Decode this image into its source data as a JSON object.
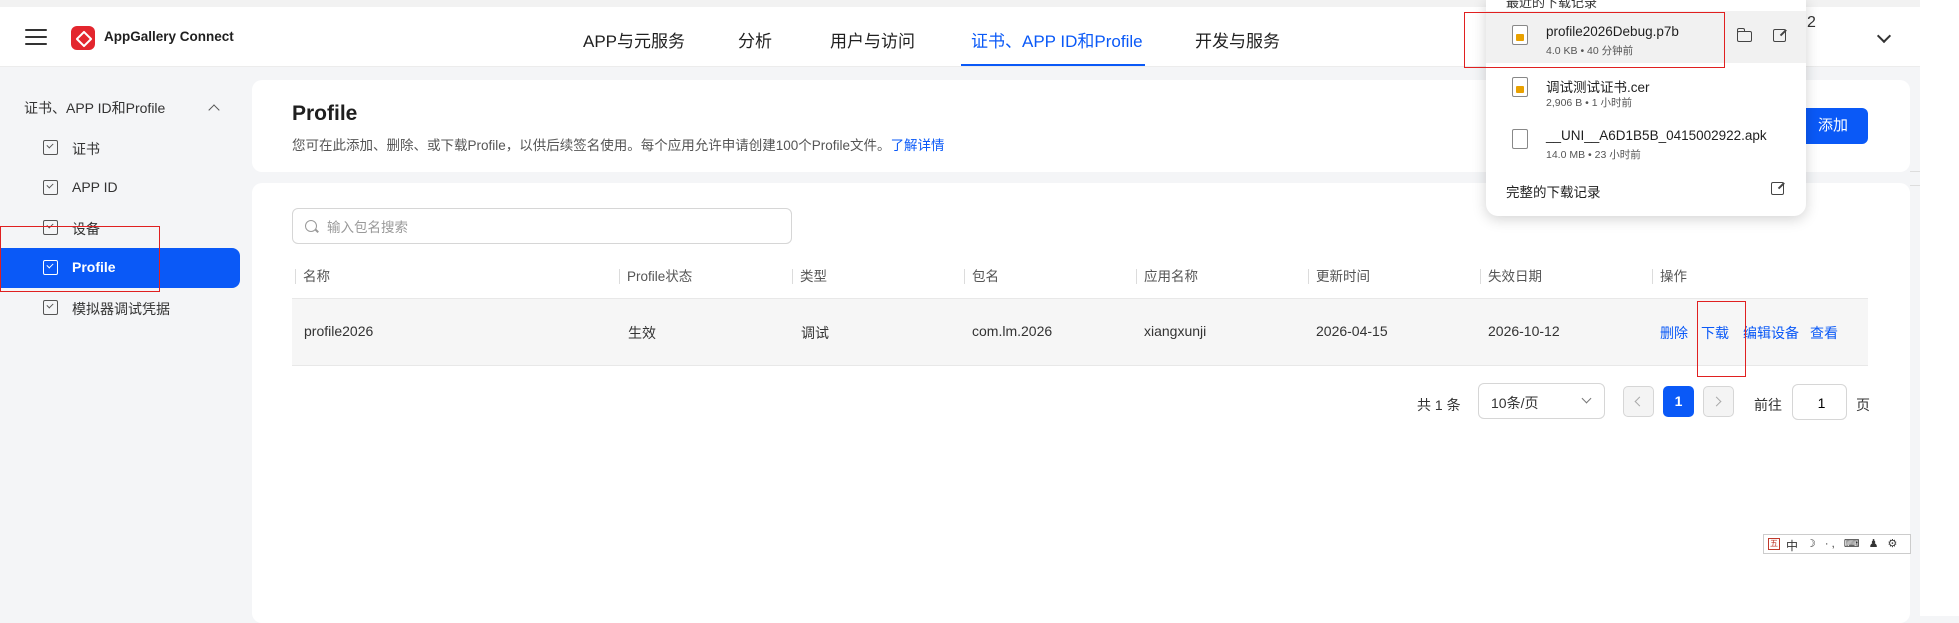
{
  "header": {
    "brand": "AppGallery Connect",
    "nav": [
      {
        "label": "APP与元服务"
      },
      {
        "label": "分析"
      },
      {
        "label": "用户与访问"
      },
      {
        "label": "证书、APP ID和Profile"
      },
      {
        "label": "开发与服务"
      }
    ],
    "right_char": "2"
  },
  "sidebar": {
    "section": "证书、APP ID和Profile",
    "items": [
      {
        "label": "证书"
      },
      {
        "label": "APP ID"
      },
      {
        "label": "设备"
      },
      {
        "label": "Profile"
      },
      {
        "label": "模拟器调试凭据"
      }
    ]
  },
  "page": {
    "title": "Profile",
    "description": "您可在此添加、删除、或下载Profile，以供后续签名使用。每个应用允许申请创建100个Profile文件。",
    "learn_more": "了解详情",
    "add_button": "添加"
  },
  "search": {
    "placeholder": "输入包名搜索",
    "value": ""
  },
  "table": {
    "headers": [
      "名称",
      "Profile状态",
      "类型",
      "包名",
      "应用名称",
      "更新时间",
      "失效日期",
      "操作"
    ],
    "rows": [
      {
        "name": "profile2026",
        "status": "生效",
        "type": "调试",
        "package": "com.lm.2026",
        "app_name": "xiangxunji",
        "updated": "2026-04-15",
        "expires": "2026-10-12",
        "actions": [
          "删除",
          "下载",
          "编辑设备",
          "查看"
        ]
      }
    ]
  },
  "pagination": {
    "total": "共 1 条",
    "page_size": "10条/页",
    "current_page": "1",
    "goto_label": "前往",
    "goto_value": "1",
    "page_suffix": "页"
  },
  "downloads": {
    "header": "最近的下载记录",
    "items": [
      {
        "name": "profile2026Debug.p7b",
        "meta": "4.0 KB • 40 分钟前"
      },
      {
        "name": "调试测试证书.cer",
        "meta": "2,906 B • 1 小时前"
      },
      {
        "name": "__UNI__A6D1B5B_0415002922.apk",
        "meta": "14.0 MB • 23 小时前"
      }
    ],
    "full_history": "完整的下载记录"
  },
  "ime": {
    "mode": "中",
    "symbols": "☽ ·, ⌨ ♟ ⚙"
  },
  "colors": {
    "accent": "#0a59f7",
    "highlight": "#e02020",
    "brand": "#e3262e"
  }
}
